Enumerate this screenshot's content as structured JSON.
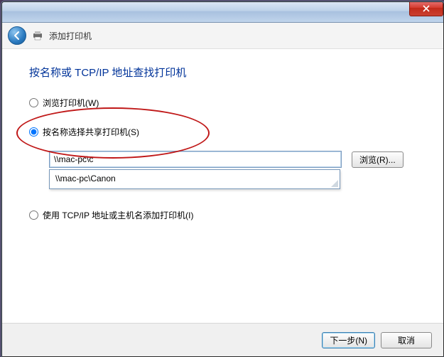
{
  "header": {
    "title": "添加打印机"
  },
  "content": {
    "heading": "按名称或 TCP/IP 地址查找打印机",
    "option_browse": "浏览打印机(W)",
    "option_by_name": "按名称选择共享打印机(S)",
    "option_by_ip": "使用 TCP/IP 地址或主机名添加打印机(I)",
    "path_value": "\\\\mac-pc\\c",
    "suggestion": "\\\\mac-pc\\Canon",
    "browse_btn": "浏览(R)..."
  },
  "footer": {
    "next": "下一步(N)",
    "cancel": "取消"
  }
}
